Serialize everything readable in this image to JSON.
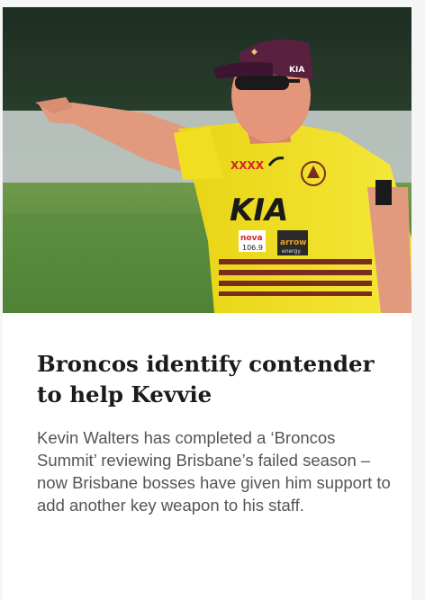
{
  "article": {
    "headline": "Broncos identify contender to help Kevvie",
    "summary": "Kevin Walters has completed a ‘Broncos Summit’ reviewing Brisbane’s failed season – now Brisbane bosses have given him support to add another key weapon to his staff.",
    "image": {
      "description_icon": "photo-coach-pointing",
      "shirt_brand": "KIA",
      "sponsor_xxxx": "XXXX",
      "sponsor_nova": "nova",
      "sponsor_nova_freq": "106.9",
      "sponsor_arrow": "arrow",
      "sponsor_arrow_sub": "energy",
      "cap_brand": "KIA"
    }
  },
  "colors": {
    "shirt": "#f2e21a",
    "cap": "#5a2040",
    "grass": "#5d8a3a",
    "text_heading": "#1b1b1b",
    "text_body": "#555555"
  }
}
